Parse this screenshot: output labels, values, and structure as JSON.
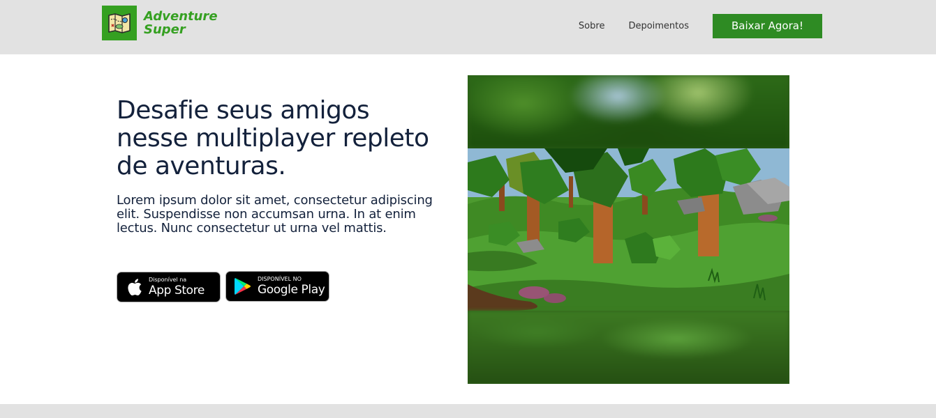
{
  "brand": {
    "name_line1": "Adventure",
    "name_line2": "Super",
    "logo_icon": "treasure-map-icon",
    "color": "#35a021"
  },
  "nav": {
    "items": [
      {
        "label": "Sobre"
      },
      {
        "label": "Depoimentos"
      }
    ],
    "cta_label": "Baixar Agora!",
    "cta_color": "#2e8b23"
  },
  "hero": {
    "title": "Desafie seus amigos nesse multiplayer repleto de aventuras.",
    "description": "Lorem ipsum dolor sit amet, consectetur adipiscing elit. Suspendisse non accumsan urna. In at enim lectus. Nunc consectetur ut urna vel mattis.",
    "text_color": "#13213b"
  },
  "badges": {
    "apple": {
      "small": "Disponível na",
      "big": "App Store",
      "icon": "apple-icon"
    },
    "google": {
      "small": "DISPONÍVEL NO",
      "big": "Google Play",
      "icon": "google-play-icon"
    }
  },
  "media": {
    "description_icon": "game-forest-screenshot"
  }
}
